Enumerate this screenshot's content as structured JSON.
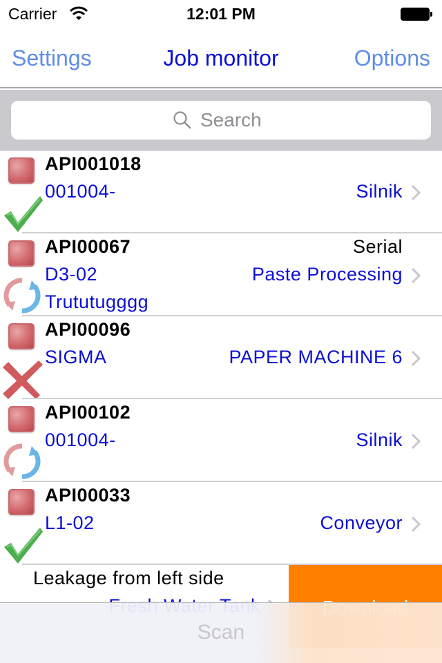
{
  "status_bar": {
    "carrier": "Carrier",
    "time": "12:01 PM",
    "wifi_icon": "wifi-icon",
    "battery_icon": "battery-full-icon"
  },
  "nav": {
    "left_button": "Settings",
    "title": "Job monitor",
    "right_button": "Options"
  },
  "search": {
    "placeholder": "Search",
    "value": "",
    "icon": "search-icon"
  },
  "colors": {
    "nav_button": "#5f8de6",
    "title_blue": "#0a0fd4",
    "download_action": "#ff8000",
    "search_bar_bg": "#c9c9ce"
  },
  "jobs": [
    {
      "id": "API001018",
      "code": "001004-",
      "location": "Silnik",
      "type": "",
      "extra": "",
      "status": "completed",
      "status_icon": "checkmark-icon"
    },
    {
      "id": "API00067",
      "code": "D3-02",
      "location": "Paste Processing",
      "type": "Serial",
      "extra": "Trututugggg",
      "status": "syncing",
      "status_icon": "sync-icon"
    },
    {
      "id": "API00096",
      "code": "SIGMA",
      "location": "PAPER MACHINE 6",
      "type": "",
      "extra": "",
      "status": "failed",
      "status_icon": "cross-icon"
    },
    {
      "id": "API00102",
      "code": "001004-",
      "location": "Silnik",
      "type": "",
      "extra": "",
      "status": "syncing",
      "status_icon": "sync-icon"
    },
    {
      "id": "API00033",
      "code": "L1-02",
      "location": "Conveyor",
      "type": "",
      "extra": "",
      "status": "completed",
      "status_icon": "checkmark-icon"
    }
  ],
  "swiped_job": {
    "description": "Leakage from left side",
    "location": "Fresh Water Tank",
    "action_label": "Download"
  },
  "toolbar": {
    "scan_label": "Scan"
  }
}
